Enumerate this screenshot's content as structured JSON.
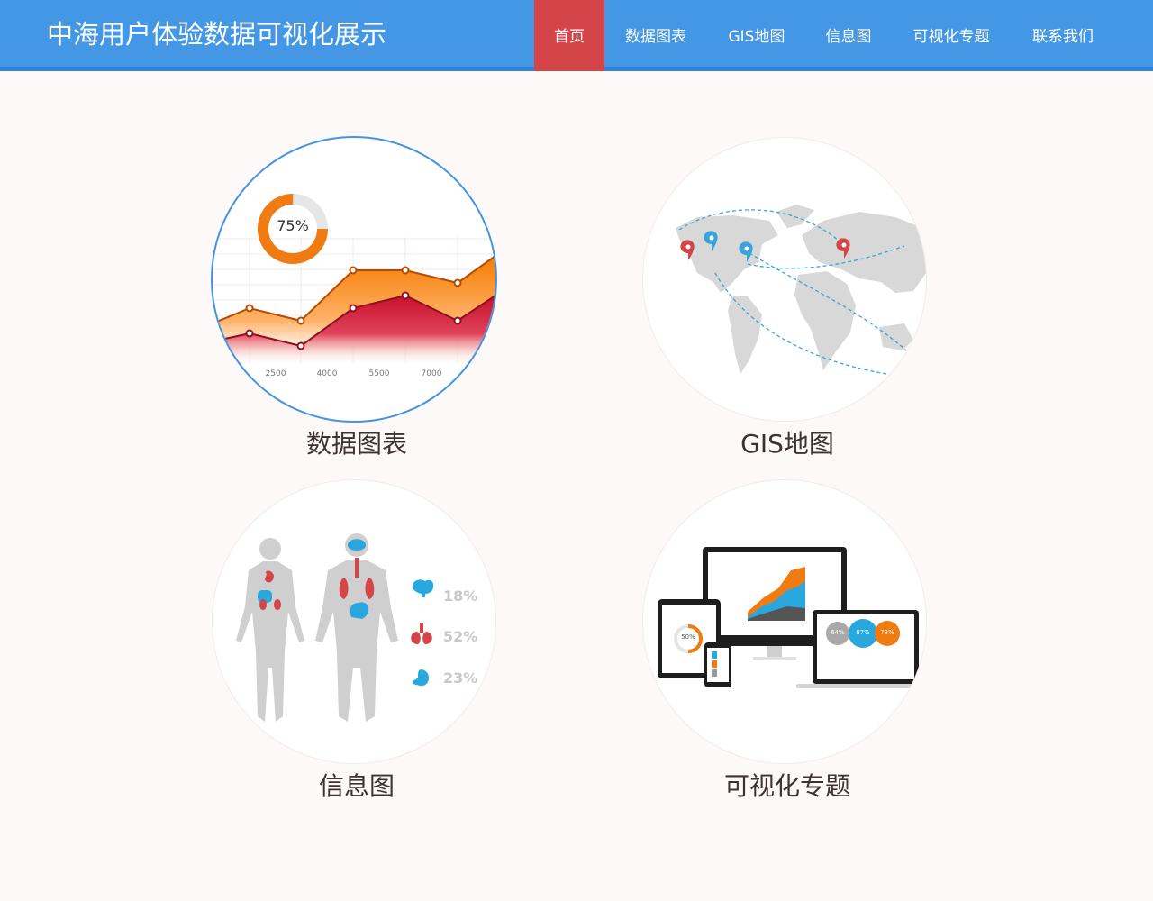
{
  "header": {
    "title": "中海用户体验数据可视化展示",
    "nav": [
      {
        "label": "首页",
        "active": true
      },
      {
        "label": "数据图表",
        "active": false
      },
      {
        "label": "GIS地图",
        "active": false
      },
      {
        "label": "信息图",
        "active": false
      },
      {
        "label": "可视化专题",
        "active": false
      },
      {
        "label": "联系我们",
        "active": false
      }
    ]
  },
  "cards": [
    {
      "label": "数据图表",
      "donut_label": "75%",
      "axis_ticks": [
        "2500",
        "4000",
        "5500",
        "7000"
      ]
    },
    {
      "label": "GIS地图"
    },
    {
      "label": "信息图",
      "stats": [
        {
          "icon": "brain-icon",
          "value": "18%"
        },
        {
          "icon": "lungs-icon",
          "value": "52%"
        },
        {
          "icon": "stomach-icon",
          "value": "23%"
        }
      ]
    },
    {
      "label": "可视化专题",
      "tablet_value": "50%",
      "laptop_values": [
        "64%",
        "87%",
        "73%"
      ]
    }
  ],
  "colors": {
    "header": "#4397e4",
    "nav_active": "#d4454a",
    "orange": "#f07b12",
    "red": "#c8102e",
    "blue": "#29a8e0",
    "body_gray": "#cfcfcf"
  }
}
